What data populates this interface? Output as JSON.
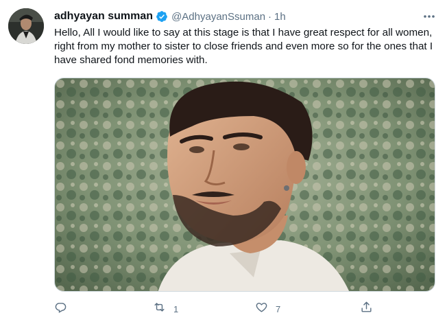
{
  "user": {
    "display_name": "adhyayan summan",
    "handle": "@AdhyayanSsuman",
    "separator": "·",
    "time": "1h",
    "verified": true
  },
  "tweet": {
    "text": "Hello, All I would like to say at this stage is that I have great respect for all women, right from my mother to sister to close friends and even more so for the ones that I have shared fond memories with."
  },
  "actions": {
    "reply_count": "",
    "retweet_count": "1",
    "like_count": "7"
  },
  "icons": {
    "more": "more-horizontal-icon",
    "reply": "reply-icon",
    "retweet": "retweet-icon",
    "like": "heart-icon",
    "share": "share-icon",
    "verified": "verified-badge-icon"
  },
  "colors": {
    "verified": "#1da1f2",
    "secondary_text": "#5b7083",
    "primary_text": "#0f1419"
  }
}
